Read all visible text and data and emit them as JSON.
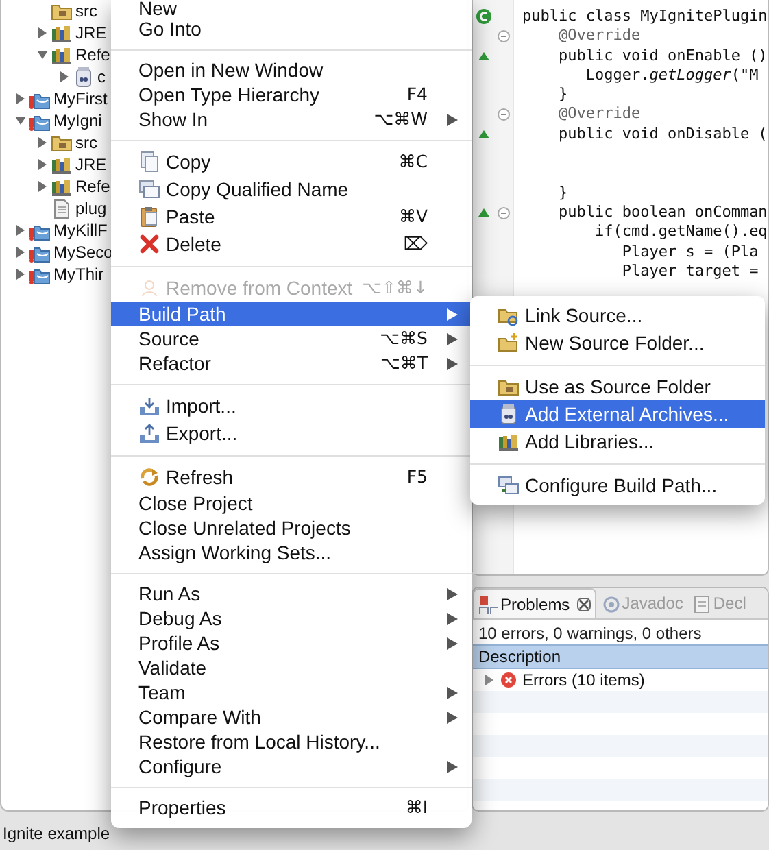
{
  "tree": {
    "partial_children": [
      {
        "label": "src",
        "kind": "source-folder"
      },
      {
        "label": "JRE",
        "kind": "library",
        "expanded": false
      },
      {
        "label": "Refe",
        "kind": "library",
        "expanded": true,
        "children": [
          {
            "label": "c",
            "kind": "jar",
            "expanded": false
          }
        ]
      }
    ],
    "projects": [
      {
        "label": "MyFirst",
        "kind": "project",
        "has_errors": true,
        "expanded": false
      },
      {
        "label": "MyIgni",
        "kind": "project",
        "has_errors": true,
        "expanded": true,
        "children": [
          {
            "label": "src",
            "kind": "source-folder",
            "expanded": false
          },
          {
            "label": "JRE",
            "kind": "library",
            "expanded": false
          },
          {
            "label": "Refe",
            "kind": "library",
            "expanded": false
          },
          {
            "label": "plug",
            "kind": "file"
          }
        ]
      },
      {
        "label": "MyKillF",
        "kind": "project",
        "has_errors": true,
        "expanded": false
      },
      {
        "label": "MySeco",
        "kind": "project",
        "has_errors": true,
        "expanded": false
      },
      {
        "label": "MyThir",
        "kind": "project",
        "has_errors": true,
        "expanded": false
      }
    ]
  },
  "editor": {
    "lines": [
      {
        "text": "public class MyIgnitePlugin",
        "kind": "class-declaration",
        "foldable": false
      },
      {
        "text": "    @Override",
        "kind": "annotation",
        "foldable": true
      },
      {
        "text": "    public void onEnable ()",
        "kind": "override-method",
        "foldable": false
      },
      {
        "text": "       Logger.*getLogger*(\"M",
        "kind": "code",
        "foldable": false
      },
      {
        "text": "    }",
        "kind": "code",
        "foldable": false
      },
      {
        "text": "    @Override",
        "kind": "annotation",
        "foldable": true
      },
      {
        "text": "    public void onDisable (",
        "kind": "override-method",
        "foldable": false
      },
      {
        "kind": "code",
        "foldable": false
      },
      {
        "kind": "code",
        "foldable": false
      },
      {
        "text": "    }",
        "kind": "code",
        "foldable": false
      },
      {
        "text": "    public boolean onComman",
        "kind": "override-method",
        "foldable": true
      },
      {
        "text": "        if(cmd.getName().eq",
        "kind": "code",
        "foldable": false
      },
      {
        "text": "           Player s = (Pla",
        "kind": "code",
        "foldable": false
      },
      {
        "text": "           Player target =",
        "kind": "code",
        "foldable": false
      }
    ]
  },
  "context_menu": {
    "groups": [
      [
        {
          "label": "New",
          "has_submenu": false,
          "disabled": false,
          "selected": false
        },
        {
          "label": "Go Into",
          "has_submenu": false,
          "disabled": false,
          "selected": false
        }
      ],
      [
        {
          "label": "Open in New Window",
          "has_submenu": false,
          "disabled": false,
          "selected": false
        },
        {
          "label": "Open Type Hierarchy",
          "shortcut": "F4",
          "has_submenu": false,
          "disabled": false,
          "selected": false
        },
        {
          "label": "Show In",
          "shortcut": "⌥⌘W",
          "has_submenu": true,
          "disabled": false,
          "selected": false
        }
      ],
      [
        {
          "label": "Copy",
          "kind": "copy",
          "shortcut": "⌘C",
          "has_submenu": false,
          "disabled": false,
          "selected": false
        },
        {
          "label": "Copy Qualified Name",
          "kind": "copy-qualified",
          "has_submenu": false,
          "disabled": false,
          "selected": false
        },
        {
          "label": "Paste",
          "kind": "paste",
          "shortcut": "⌘V",
          "has_submenu": false,
          "disabled": false,
          "selected": false
        },
        {
          "label": "Delete",
          "kind": "delete",
          "shortcut": "⌦",
          "has_submenu": false,
          "disabled": false,
          "selected": false
        }
      ],
      [
        {
          "label": "Remove from Context",
          "kind": "remove",
          "shortcut": "⌥⇧⌘↓",
          "has_submenu": false,
          "disabled": true,
          "selected": false
        },
        {
          "label": "Build Path",
          "has_submenu": true,
          "disabled": false,
          "selected": true
        },
        {
          "label": "Source",
          "shortcut": "⌥⌘S",
          "has_submenu": true,
          "disabled": false,
          "selected": false
        },
        {
          "label": "Refactor",
          "shortcut": "⌥⌘T",
          "has_submenu": true,
          "disabled": false,
          "selected": false
        }
      ],
      [
        {
          "label": "Import...",
          "kind": "import",
          "has_submenu": false,
          "disabled": false,
          "selected": false
        },
        {
          "label": "Export...",
          "kind": "export",
          "has_submenu": false,
          "disabled": false,
          "selected": false
        }
      ],
      [
        {
          "label": "Refresh",
          "kind": "refresh",
          "shortcut": "F5",
          "has_submenu": false,
          "disabled": false,
          "selected": false
        },
        {
          "label": "Close Project",
          "has_submenu": false,
          "disabled": false,
          "selected": false
        },
        {
          "label": "Close Unrelated Projects",
          "has_submenu": false,
          "disabled": false,
          "selected": false
        },
        {
          "label": "Assign Working Sets...",
          "has_submenu": false,
          "disabled": false,
          "selected": false
        }
      ],
      [
        {
          "label": "Run As",
          "has_submenu": true,
          "disabled": false,
          "selected": false
        },
        {
          "label": "Debug As",
          "has_submenu": true,
          "disabled": false,
          "selected": false
        },
        {
          "label": "Profile As",
          "has_submenu": true,
          "disabled": false,
          "selected": false
        },
        {
          "label": "Validate",
          "has_submenu": false,
          "disabled": false,
          "selected": false
        },
        {
          "label": "Team",
          "has_submenu": true,
          "disabled": false,
          "selected": false
        },
        {
          "label": "Compare With",
          "has_submenu": true,
          "disabled": false,
          "selected": false
        },
        {
          "label": "Restore from Local History...",
          "has_submenu": false,
          "disabled": false,
          "selected": false
        },
        {
          "label": "Configure",
          "has_submenu": true,
          "disabled": false,
          "selected": false
        }
      ],
      [
        {
          "label": "Properties",
          "shortcut": "⌘I",
          "has_submenu": false,
          "disabled": false,
          "selected": false
        }
      ]
    ]
  },
  "submenu": {
    "groups": [
      [
        {
          "label": "Link Source...",
          "kind": "link-source",
          "selected": false
        },
        {
          "label": "New Source Folder...",
          "kind": "new-source-folder",
          "selected": false
        }
      ],
      [
        {
          "label": "Use as Source Folder",
          "kind": "use-source-folder",
          "selected": false
        },
        {
          "label": "Add External Archives...",
          "kind": "archive",
          "selected": true
        },
        {
          "label": "Add Libraries...",
          "kind": "libraries",
          "selected": false
        }
      ],
      [
        {
          "label": "Configure Build Path...",
          "kind": "configure",
          "selected": false
        }
      ]
    ]
  },
  "problems": {
    "tabs": [
      {
        "label": "Problems",
        "kind": "problems",
        "selected": true
      },
      {
        "label": "Javadoc",
        "kind": "javadoc",
        "selected": false
      },
      {
        "label": "Decl",
        "kind": "declaration",
        "selected": false
      }
    ],
    "summary": "10 errors, 0 warnings, 0 others",
    "column": "Description",
    "rows": [
      {
        "label": "Errors (10 items)",
        "kind": "error",
        "expanded": false
      }
    ]
  },
  "status_bar": "Ignite example"
}
